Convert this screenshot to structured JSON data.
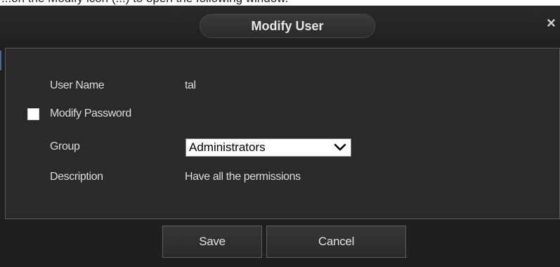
{
  "background_caption": "...on the Modify icon (...) to open the following window.",
  "dialog": {
    "title": "Modify User",
    "close_glyph": "×"
  },
  "form": {
    "username_label": "User Name",
    "username_value": "tal",
    "modify_password_label": "Modify Password",
    "modify_password_checked": false,
    "group_label": "Group",
    "group_selected": "Administrators",
    "description_label": "Description",
    "description_value": "Have all the permissions"
  },
  "buttons": {
    "save_label": "Save",
    "cancel_label": "Cancel"
  },
  "colors": {
    "dialog_background": "#1f1f1f",
    "panel_background": "#2a2a2a",
    "text": "#dcdcdc",
    "accent_marker": "#4a6a9a"
  },
  "icons": {
    "close": "close-icon",
    "dropdown": "chevron-down-icon",
    "checkbox": "checkbox-icon"
  }
}
